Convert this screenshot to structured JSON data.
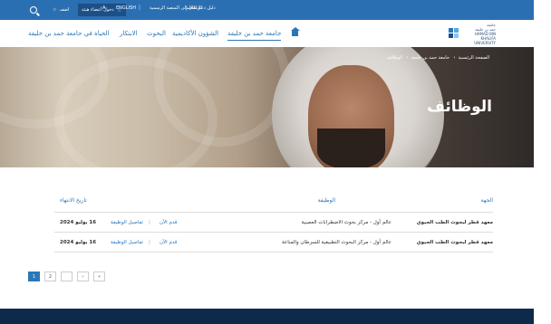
{
  "topbar": {
    "link_student_services": "دليل دعم التعلم",
    "link_portal": "الإنتقال إلى المنصة الرسمية",
    "language": "ENGLISH",
    "font_size": "A",
    "user_button": "دخول أعضاء هيئة",
    "favorites": "اضف",
    "icons": [
      "search-icon",
      "user-icon",
      "star-icon"
    ]
  },
  "logo": {
    "line1": "جامعة",
    "line2": "حمد بن خليفة",
    "line3": "HAMAD BIN KHALIFA",
    "line4": "UNIVERSITY"
  },
  "nav": {
    "items": [
      "جامعة حمد بن خليفة",
      "الشؤون الأكاديمية",
      "البحوث",
      "الابتكار",
      "الحياة في جامعة حمد بن خليفة"
    ],
    "active_index": 0
  },
  "hero": {
    "breadcrumb": [
      "الصفحة الرئيسية",
      "جامعة حمد بن خليفة",
      "الوظائف"
    ],
    "title": "الوظائف"
  },
  "jobs": {
    "headers": {
      "entity": "الجهة",
      "title": "الوظيفة",
      "deadline": "تاريخ الانتهاء"
    },
    "rows": [
      {
        "entity": "معهد قطر لبحوث الطب الحيوي",
        "title": "عالم أول - مركز بحوث الاضطرابات العصبية",
        "apply": "قدم الآن",
        "details": "تفاصيل الوظيفة",
        "date": "16 يوليو 2024"
      },
      {
        "entity": "معهد قطر لبحوث الطب الحيوي",
        "title": "عالم أول - مركز البحوث التطبيقية للسرطان والمناعة",
        "apply": "قدم الآن",
        "details": "تفاصيل الوظيفة",
        "date": "16 يوليو 2024"
      }
    ]
  },
  "pagination": {
    "pages": [
      "1",
      "2"
    ],
    "current": "1",
    "prev": "‹",
    "first": "«"
  },
  "colors": {
    "primary": "#2a77b8",
    "topbar": "#2b6fb3",
    "footer": "#0e2a4a"
  }
}
